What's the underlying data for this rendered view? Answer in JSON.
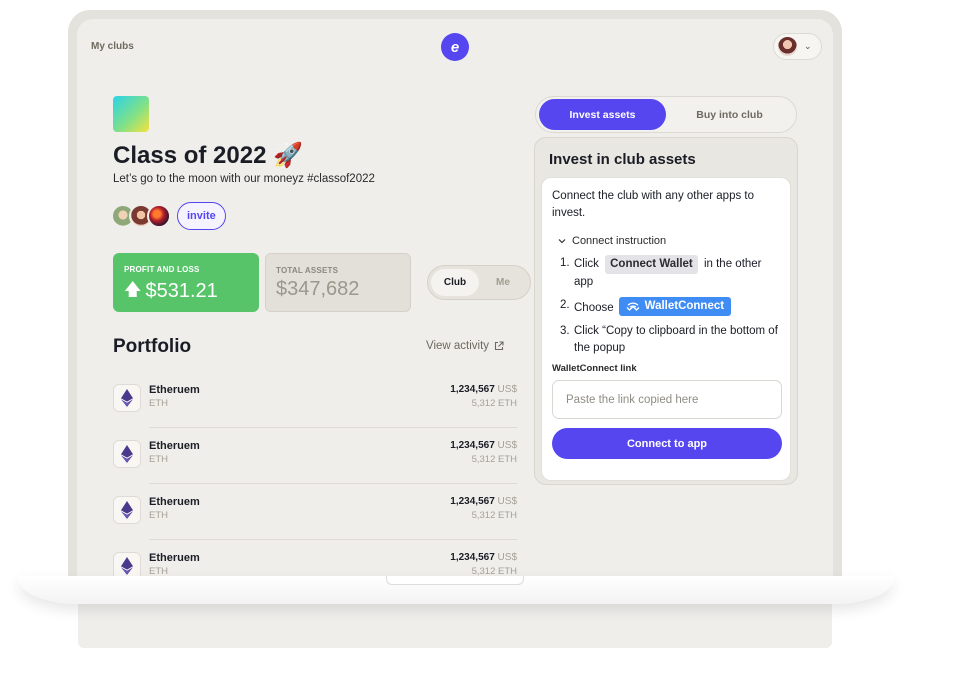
{
  "header": {
    "my_clubs": "My clubs",
    "logo_glyph": "e",
    "user_chevron": "⌄"
  },
  "club": {
    "title": "Class of 2022",
    "emoji": "🚀",
    "description": "Let’s go to the moon with our moneyz #classof2022",
    "invite_label": "invite"
  },
  "stats": {
    "pnl_label": "PROFIT AND LOSS",
    "pnl_value": "$531.21",
    "pnl_arrow": "🡅",
    "assets_label": "TOTAL ASSETS",
    "assets_value": "$347,682",
    "toggle": [
      "Club",
      "Me"
    ],
    "toggle_active": "Club",
    "pnl_color": "#58c46a"
  },
  "portfolio": {
    "title": "Portfolio",
    "view_activity": "View activity",
    "assets": [
      {
        "name": "Etheruem",
        "symbol": "ETH",
        "usd": "1,234,567",
        "usd_cur": "US$",
        "eth": "5,312 ETH"
      },
      {
        "name": "Etheruem",
        "symbol": "ETH",
        "usd": "1,234,567",
        "usd_cur": "US$",
        "eth": "5,312 ETH"
      },
      {
        "name": "Etheruem",
        "symbol": "ETH",
        "usd": "1,234,567",
        "usd_cur": "US$",
        "eth": "5,312 ETH"
      },
      {
        "name": "Etheruem",
        "symbol": "ETH",
        "usd": "1,234,567",
        "usd_cur": "US$",
        "eth": "5,312 ETH"
      }
    ]
  },
  "invest": {
    "tabs": [
      "Invest assets",
      "Buy into club"
    ],
    "active_tab": "Invest assets",
    "title": "Invest in club assets",
    "intro": "Connect the club with any other apps to invest.",
    "instruction_toggle": "Connect instruction",
    "step1_num": "1.",
    "step1_pre": "Click",
    "step1_chip": "Connect Wallet",
    "step1_post": "in the other app",
    "step2_num": "2.",
    "step2_pre": "Choose",
    "step2_chip": "WalletConnect",
    "step3_num": "3.",
    "step3_text": "Click “Copy to clipboard in the bottom of the popup",
    "link_label": "WalletConnect link",
    "link_placeholder": "Paste the link copied here",
    "link_value": "",
    "connect_button": "Connect to app",
    "accent_color": "#5546f0",
    "walletconnect_color": "#3f8cf4"
  }
}
